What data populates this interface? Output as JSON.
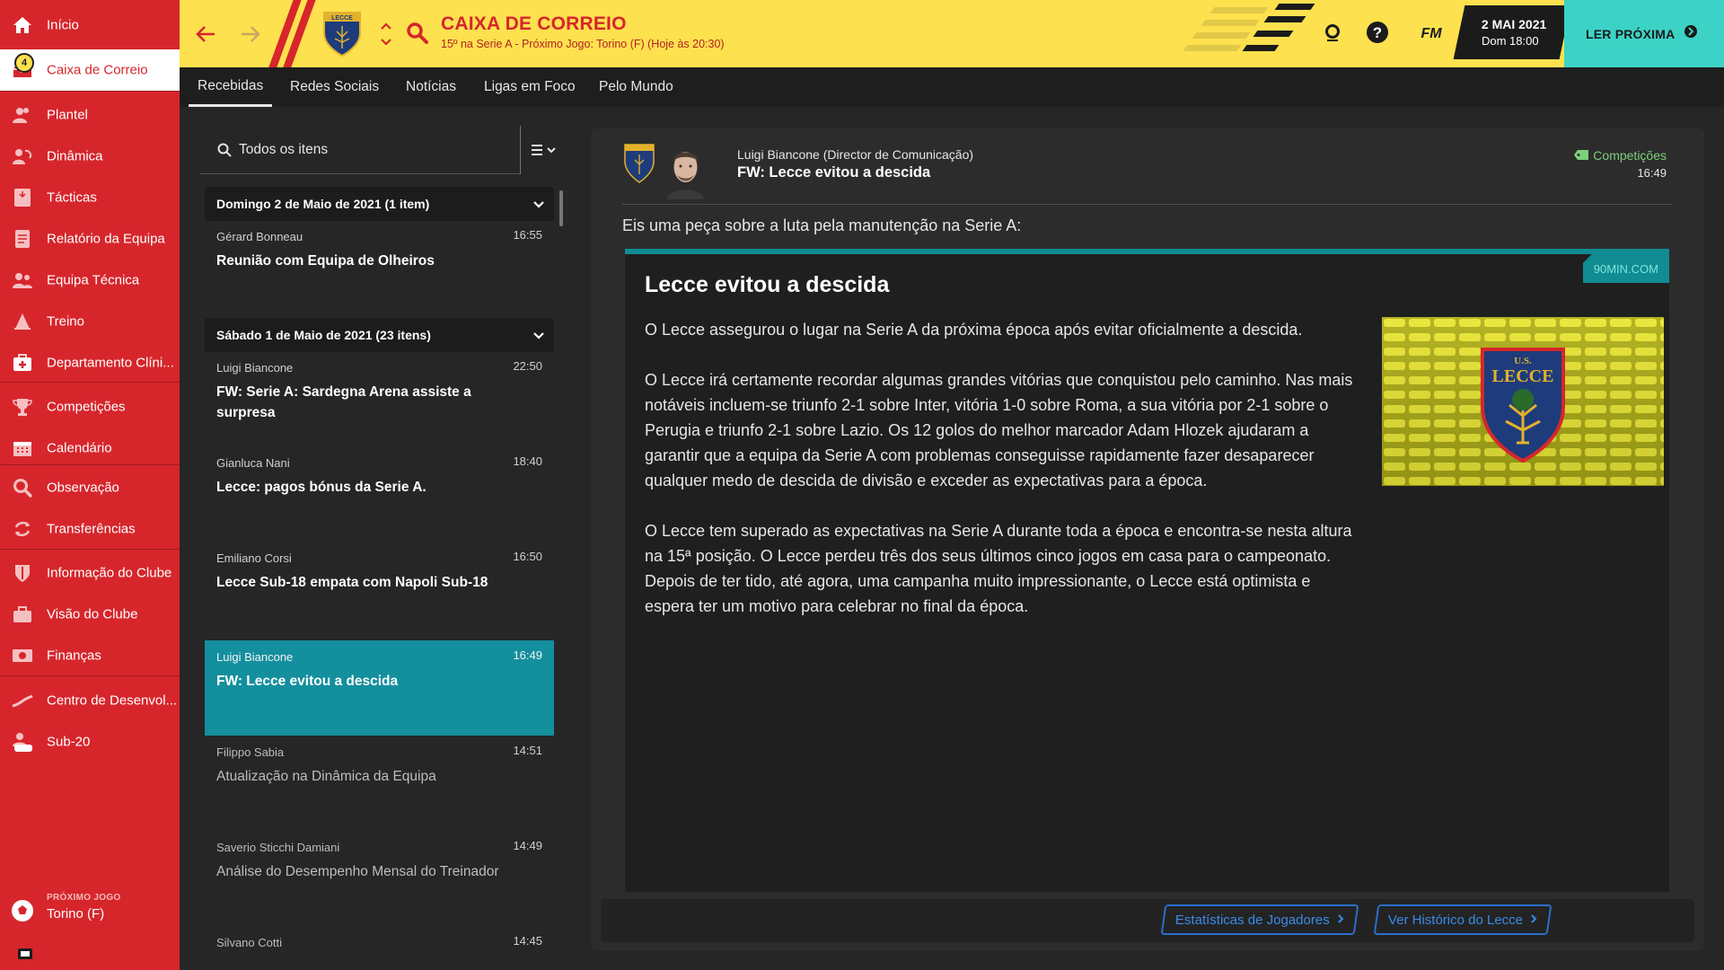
{
  "sidebar": {
    "items": [
      {
        "label": "Início",
        "icon": "home-icon"
      },
      {
        "label": "Caixa de Correio",
        "icon": "inbox-icon",
        "badge": "4"
      },
      {
        "label": "Plantel",
        "icon": "squad-icon"
      },
      {
        "label": "Dinâmica",
        "icon": "dynamics-icon"
      },
      {
        "label": "Tácticas",
        "icon": "tactics-icon"
      },
      {
        "label": "Relatório da Equipa",
        "icon": "report-icon"
      },
      {
        "label": "Equipa Técnica",
        "icon": "staff-icon"
      },
      {
        "label": "Treino",
        "icon": "training-icon"
      },
      {
        "label": "Departamento Clíni...",
        "icon": "medical-icon"
      },
      {
        "label": "Competições",
        "icon": "trophy-icon"
      },
      {
        "label": "Calendário",
        "icon": "calendar-icon"
      },
      {
        "label": "Observação",
        "icon": "scouting-icon"
      },
      {
        "label": "Transferências",
        "icon": "transfers-icon"
      },
      {
        "label": "Informação do Clube",
        "icon": "club-info-icon"
      },
      {
        "label": "Visão do Clube",
        "icon": "club-vision-icon"
      },
      {
        "label": "Finanças",
        "icon": "finances-icon"
      },
      {
        "label": "Centro de Desenvol...",
        "icon": "development-icon"
      },
      {
        "label": "Sub-20",
        "icon": "u20-icon"
      }
    ],
    "next_match": {
      "label": "PRÓXIMO JOGO",
      "value": "Torino (F)"
    }
  },
  "header": {
    "title": "CAIXA DE CORREIO",
    "subtitle": "15º na Serie A - Próximo Jogo: Torino (F) (Hoje às 20:30)",
    "date": "2 MAI 2021",
    "time": "Dom 18:00",
    "fm_label": "FM",
    "continue_label": "LER PRÓXIMA",
    "crest_text": "LECCE"
  },
  "tabs": [
    "Recebidas",
    "Redes Sociais",
    "Notícias",
    "Ligas em Foco",
    "Pelo Mundo"
  ],
  "inbox": {
    "search_placeholder": "Todos os itens",
    "groups": [
      {
        "title": "Domingo 2 de Maio de 2021 (1 item)"
      },
      {
        "title": "Sábado 1 de Maio de 2021 (23 itens)"
      }
    ],
    "messages": [
      {
        "sender": "Gérard Bonneau",
        "time": "16:55",
        "subject": "Reunião com Equipa de Olheiros"
      },
      {
        "sender": "Luigi Biancone",
        "time": "22:50",
        "subject": "FW: Serie A: Sardegna Arena assiste a surpresa"
      },
      {
        "sender": "Gianluca Nani",
        "time": "18:40",
        "subject": "Lecce: pagos bónus da Serie A."
      },
      {
        "sender": "Emiliano Corsi",
        "time": "16:50",
        "subject": "Lecce Sub-18 empata com Napoli Sub-18"
      },
      {
        "sender": "Luigi Biancone",
        "time": "16:49",
        "subject": "FW: Lecce evitou a descida"
      },
      {
        "sender": "Filippo Sabia",
        "time": "14:51",
        "subject": "Atualização na Dinâmica da Equipa"
      },
      {
        "sender": "Saverio Sticchi Damiani",
        "time": "14:49",
        "subject": "Análise do Desempenho Mensal do Treinador"
      },
      {
        "sender": "Silvano Cotti",
        "time": "14:45",
        "subject": ""
      }
    ]
  },
  "message": {
    "from": "Luigi Biancone  (Director de Comunicação)",
    "title": "FW: Lecce evitou a descida",
    "category": "Competições",
    "time": "16:49",
    "intro": "Eis uma peça sobre a luta pela manutenção na Serie A:",
    "article": {
      "source": "90MIN.COM",
      "title": "Lecce evitou a descida",
      "paragraphs": [
        "O Lecce assegurou o lugar na Serie A da próxima época após evitar oficialmente a descida.",
        "O Lecce irá certamente recordar algumas grandes vitórias que conquistou pelo caminho. Nas mais notáveis incluem-se triunfo 2-1 sobre Inter, vitória 1-0 sobre Roma, a sua vitória por 2-1 sobre o Perugia e triunfo 2-1 sobre Lazio. Os 12 golos do melhor marcador Adam Hlozek ajudaram a garantir que a equipa da Serie A com problemas conseguisse rapidamente fazer desaparecer qualquer medo de descida de divisão e exceder as expectativas para a época.",
        "O Lecce tem superado as expectativas na Serie A durante toda a época e encontra-se nesta altura na 15ª posição. O Lecce perdeu três dos seus últimos cinco jogos em casa para o campeonato. Depois de ter tido, até agora, uma campanha muito impressionante, o Lecce está optimista e espera ter um motivo para celebrar no final da época."
      ],
      "image_crest_top": "U.S.",
      "image_crest_name": "LECCE"
    },
    "buttons": [
      "Estatísticas de Jogadores",
      "Ver Histórico do Lecce"
    ]
  },
  "colors": {
    "sidebar": "#d6262c",
    "header": "#fde14e",
    "accent_teal": "#138f9d",
    "continue": "#3cd3c6",
    "link_blue": "#3a8be8"
  }
}
